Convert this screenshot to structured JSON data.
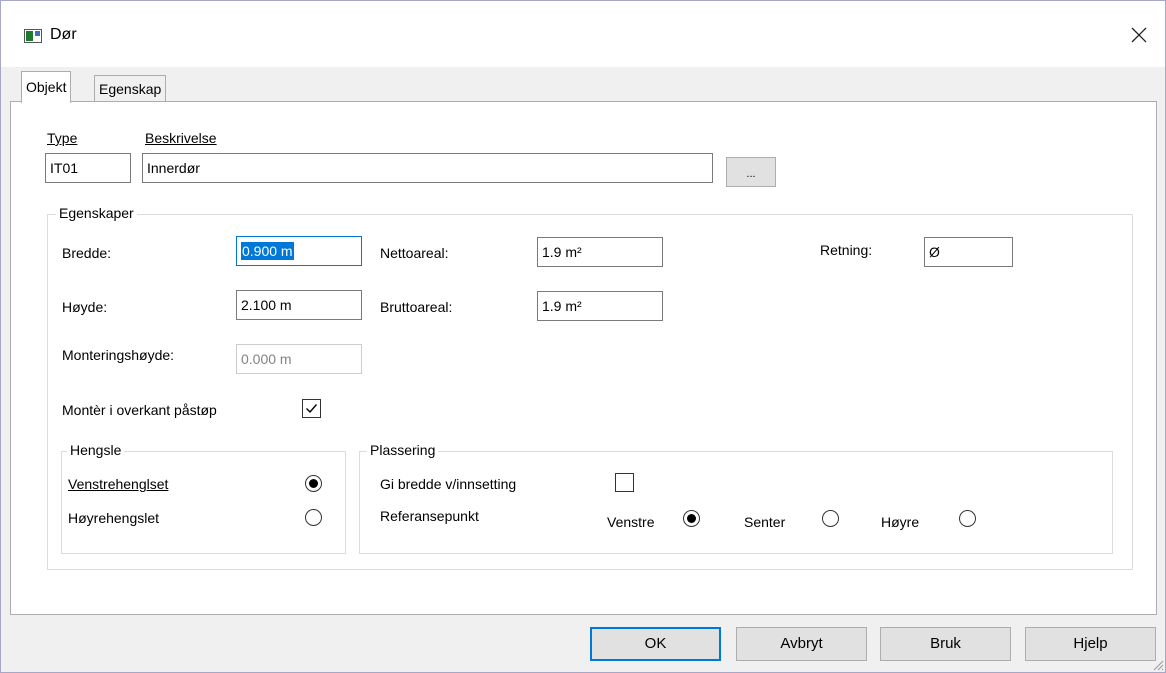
{
  "window": {
    "title": "Dør"
  },
  "tabs": [
    {
      "label": "Objekt",
      "active": true
    },
    {
      "label": "Egenskap",
      "active": false
    }
  ],
  "header": {
    "type_label": "Type",
    "type_value": "IT01",
    "description_label": "Beskrivelse",
    "description_value": "Innerdør",
    "browse_label": "..."
  },
  "properties": {
    "group_label": "Egenskaper",
    "width_label": "Bredde:",
    "width_value": "0.900 m",
    "height_label": "Høyde:",
    "height_value": "2.100 m",
    "mount_height_label": "Monteringshøyde:",
    "mount_height_value": "0.000 m",
    "net_area_label": "Nettoareal:",
    "net_area_value": "1.9 m²",
    "gross_area_label": "Bruttoareal:",
    "gross_area_value": "1.9 m²",
    "direction_label": "Retning:",
    "direction_value": "Ø",
    "mount_top_label": "Montèr i overkant påstøp",
    "mount_top_checked": true
  },
  "hinge": {
    "group_label": "Hengsle",
    "left_label": "Venstrehenglset",
    "left_selected": true,
    "right_label": "Høyrehengslet",
    "right_selected": false
  },
  "placement": {
    "group_label": "Plassering",
    "set_width_label": "Gi bredde v/innsetting",
    "set_width_checked": false,
    "reference_label": "Referansepunkt",
    "left_label": "Venstre",
    "left_selected": true,
    "center_label": "Senter",
    "center_selected": false,
    "right_label": "Høyre",
    "right_selected": false
  },
  "buttons": {
    "ok": "OK",
    "cancel": "Avbryt",
    "apply": "Bruk",
    "help": "Hjelp"
  },
  "colors": {
    "accent": "#0078d7",
    "panel": "#ffffff",
    "window_bg": "#f0f0f0",
    "border": "#adadad"
  }
}
